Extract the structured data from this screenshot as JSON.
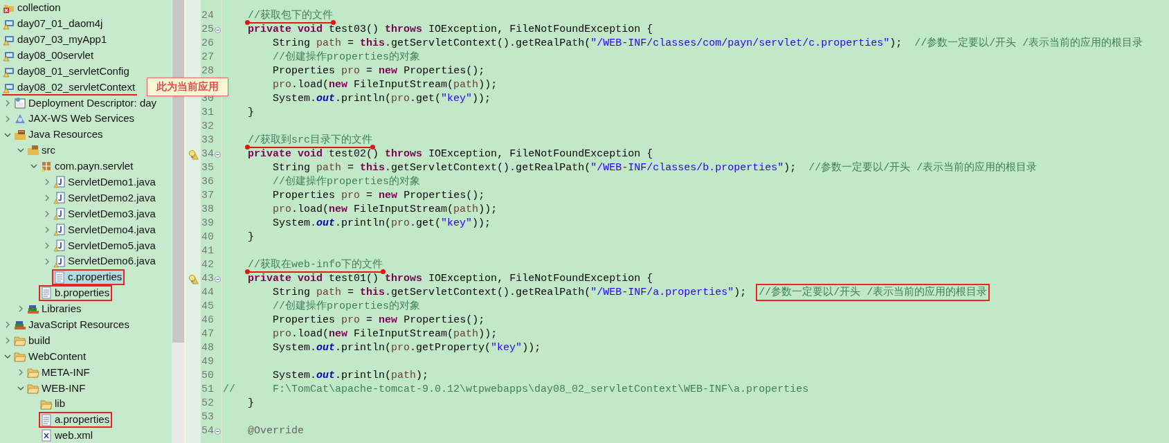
{
  "project_explorer": {
    "items": [
      {
        "label": "collection",
        "kind": "project-error",
        "selected": false
      },
      {
        "label": "day07_01_daom4j",
        "kind": "project",
        "selected": false
      },
      {
        "label": "day07_03_myApp1",
        "kind": "project",
        "selected": false
      },
      {
        "label": "day08_00servlet",
        "kind": "project",
        "selected": false
      },
      {
        "label": "day08_01_servletConfig",
        "kind": "project",
        "selected": false
      },
      {
        "label": "day08_02_servletContext",
        "kind": "project",
        "selected": false,
        "underlined": true,
        "children": [
          {
            "label": "Deployment Descriptor: day",
            "kind": "deployment",
            "expanded": false,
            "selected": false
          },
          {
            "label": "JAX-WS Web Services",
            "kind": "webservices",
            "expanded": false,
            "selected": false
          },
          {
            "label": "Java Resources",
            "kind": "java-resources",
            "expanded": true,
            "selected": false,
            "children": [
              {
                "label": "src",
                "kind": "src-folder",
                "expanded": true,
                "selected": false,
                "children": [
                  {
                    "label": "com.payn.servlet",
                    "kind": "package",
                    "expanded": true,
                    "selected": false,
                    "children": [
                      {
                        "label": "ServletDemo1.java",
                        "kind": "java-file",
                        "expanded": false,
                        "selected": false
                      },
                      {
                        "label": "ServletDemo2.java",
                        "kind": "java-file",
                        "expanded": false,
                        "selected": false
                      },
                      {
                        "label": "ServletDemo3.java",
                        "kind": "java-file",
                        "expanded": false,
                        "selected": false
                      },
                      {
                        "label": "ServletDemo4.java",
                        "kind": "java-file",
                        "expanded": false,
                        "selected": false
                      },
                      {
                        "label": "ServletDemo5.java",
                        "kind": "java-file",
                        "expanded": false,
                        "selected": false
                      },
                      {
                        "label": "ServletDemo6.java",
                        "kind": "java-file",
                        "expanded": false,
                        "selected": false
                      },
                      {
                        "label": "c.properties",
                        "kind": "text-file",
                        "selected": true,
                        "boxed": true
                      }
                    ]
                  },
                  {
                    "label": "b.properties",
                    "kind": "text-file",
                    "selected": false,
                    "boxed": true
                  }
                ]
              },
              {
                "label": "Libraries",
                "kind": "library",
                "expanded": false,
                "selected": false
              }
            ]
          },
          {
            "label": "JavaScript Resources",
            "kind": "library",
            "expanded": false,
            "selected": false
          },
          {
            "label": "build",
            "kind": "folder",
            "expanded": false,
            "selected": false
          },
          {
            "label": "WebContent",
            "kind": "folder",
            "expanded": true,
            "selected": false,
            "children": [
              {
                "label": "META-INF",
                "kind": "folder",
                "expanded": false,
                "selected": false
              },
              {
                "label": "WEB-INF",
                "kind": "folder",
                "expanded": true,
                "selected": false,
                "children": [
                  {
                    "label": "lib",
                    "kind": "folder",
                    "selected": false
                  },
                  {
                    "label": "a.properties",
                    "kind": "text-file",
                    "selected": false,
                    "boxed": true
                  },
                  {
                    "label": "web.xml",
                    "kind": "xml-file",
                    "selected": false
                  }
                ]
              }
            ]
          }
        ]
      }
    ]
  },
  "callout": {
    "text": "此为当前应用"
  },
  "editor": {
    "lines": [
      {
        "number": "24",
        "tokens": [
          {
            "kind": "comment",
            "text": "    //获取包下的文件",
            "underlined": true
          }
        ]
      },
      {
        "number": "25",
        "fold": true,
        "tokens": [
          {
            "kind": "keyword",
            "text": "    private void"
          },
          {
            "kind": "plain",
            "text": " test03() "
          },
          {
            "kind": "keyword",
            "text": "throws"
          },
          {
            "kind": "plain",
            "text": " IOException, FileNotFoundException {"
          }
        ]
      },
      {
        "number": "26",
        "tokens": [
          {
            "kind": "plain",
            "text": "        String "
          },
          {
            "kind": "local",
            "text": "path"
          },
          {
            "kind": "plain",
            "text": " = "
          },
          {
            "kind": "keyword",
            "text": "this"
          },
          {
            "kind": "plain",
            "text": ".getServletContext().getRealPath("
          },
          {
            "kind": "string",
            "text": "\"/WEB-INF/classes/com/payn/servlet/c.properties\""
          },
          {
            "kind": "plain",
            "text": ");  "
          },
          {
            "kind": "comment",
            "text": "//参数一定要以/开头 /表示当前的应用的根目录"
          }
        ]
      },
      {
        "number": "27",
        "tokens": [
          {
            "kind": "comment",
            "text": "        //创建操作properties的对象"
          }
        ]
      },
      {
        "number": "28",
        "tokens": [
          {
            "kind": "plain",
            "text": "        Properties "
          },
          {
            "kind": "local",
            "text": "pro"
          },
          {
            "kind": "plain",
            "text": " = "
          },
          {
            "kind": "keyword",
            "text": "new"
          },
          {
            "kind": "plain",
            "text": " Properties();"
          }
        ]
      },
      {
        "tokens": [
          {
            "kind": "local",
            "text": "        pro"
          },
          {
            "kind": "plain",
            "text": ".load("
          },
          {
            "kind": "keyword",
            "text": "new"
          },
          {
            "kind": "plain",
            "text": " FileInputStream("
          },
          {
            "kind": "local",
            "text": "path"
          },
          {
            "kind": "plain",
            "text": "));"
          }
        ]
      },
      {
        "number": "30",
        "tokens": [
          {
            "kind": "plain",
            "text": "        System."
          },
          {
            "kind": "field",
            "text": "out"
          },
          {
            "kind": "plain",
            "text": ".println("
          },
          {
            "kind": "local",
            "text": "pro"
          },
          {
            "kind": "plain",
            "text": ".get("
          },
          {
            "kind": "string",
            "text": "\"key\""
          },
          {
            "kind": "plain",
            "text": "));"
          }
        ]
      },
      {
        "number": "31",
        "tokens": [
          {
            "kind": "plain",
            "text": "    }"
          }
        ]
      },
      {
        "number": "32"
      },
      {
        "number": "33",
        "tokens": [
          {
            "kind": "comment",
            "text": "    //获取到src目录下的文件",
            "underlined": true
          }
        ]
      },
      {
        "number": "34",
        "fold": true,
        "warning": true,
        "tokens": [
          {
            "kind": "keyword",
            "text": "    private void"
          },
          {
            "kind": "plain",
            "text": " test02() "
          },
          {
            "kind": "keyword",
            "text": "throws"
          },
          {
            "kind": "plain",
            "text": " IOException, FileNotFoundException {"
          }
        ]
      },
      {
        "number": "35",
        "tokens": [
          {
            "kind": "plain",
            "text": "        String "
          },
          {
            "kind": "local",
            "text": "path"
          },
          {
            "kind": "plain",
            "text": " = "
          },
          {
            "kind": "keyword",
            "text": "this"
          },
          {
            "kind": "plain",
            "text": ".getServletContext().getRealPath("
          },
          {
            "kind": "string",
            "text": "\"/WEB-INF/classes/b.properties\""
          },
          {
            "kind": "plain",
            "text": ");  "
          },
          {
            "kind": "comment",
            "text": "//参数一定要以/开头 /表示当前的应用的根目录"
          }
        ]
      },
      {
        "number": "36",
        "tokens": [
          {
            "kind": "comment",
            "text": "        //创建操作properties的对象"
          }
        ]
      },
      {
        "number": "37",
        "tokens": [
          {
            "kind": "plain",
            "text": "        Properties "
          },
          {
            "kind": "local",
            "text": "pro"
          },
          {
            "kind": "plain",
            "text": " = "
          },
          {
            "kind": "keyword",
            "text": "new"
          },
          {
            "kind": "plain",
            "text": " Properties();"
          }
        ]
      },
      {
        "number": "38",
        "tokens": [
          {
            "kind": "local",
            "text": "        pro"
          },
          {
            "kind": "plain",
            "text": ".load("
          },
          {
            "kind": "keyword",
            "text": "new"
          },
          {
            "kind": "plain",
            "text": " FileInputStream("
          },
          {
            "kind": "local",
            "text": "path"
          },
          {
            "kind": "plain",
            "text": "));"
          }
        ]
      },
      {
        "number": "39",
        "tokens": [
          {
            "kind": "plain",
            "text": "        System."
          },
          {
            "kind": "field",
            "text": "out"
          },
          {
            "kind": "plain",
            "text": ".println("
          },
          {
            "kind": "local",
            "text": "pro"
          },
          {
            "kind": "plain",
            "text": ".get("
          },
          {
            "kind": "string",
            "text": "\"key\""
          },
          {
            "kind": "plain",
            "text": "));"
          }
        ]
      },
      {
        "number": "40",
        "tokens": [
          {
            "kind": "plain",
            "text": "    }"
          }
        ]
      },
      {
        "number": "41"
      },
      {
        "number": "42",
        "tokens": [
          {
            "kind": "comment",
            "text": "    //获取在web-info下的文件",
            "underlined": true
          }
        ]
      },
      {
        "number": "43",
        "fold": true,
        "warning": true,
        "tokens": [
          {
            "kind": "keyword",
            "text": "    private void"
          },
          {
            "kind": "plain",
            "text": " test01() "
          },
          {
            "kind": "keyword",
            "text": "throws"
          },
          {
            "kind": "plain",
            "text": " IOException, FileNotFoundException {"
          }
        ]
      },
      {
        "number": "44",
        "tokens": [
          {
            "kind": "plain",
            "text": "        String "
          },
          {
            "kind": "local",
            "text": "path"
          },
          {
            "kind": "plain",
            "text": " = "
          },
          {
            "kind": "keyword",
            "text": "this"
          },
          {
            "kind": "plain",
            "text": ".getServletContext().getRealPath("
          },
          {
            "kind": "string",
            "text": "\"/WEB-INF/a.properties\""
          },
          {
            "kind": "plain",
            "text": ");  "
          },
          {
            "kind": "comment",
            "text": "//参数一定要以/开头 /表示当前的应用的根目录",
            "boxed": true
          }
        ]
      },
      {
        "number": "45",
        "tokens": [
          {
            "kind": "comment",
            "text": "        //创建操作properties的对象"
          }
        ]
      },
      {
        "number": "46",
        "tokens": [
          {
            "kind": "plain",
            "text": "        Properties "
          },
          {
            "kind": "local",
            "text": "pro"
          },
          {
            "kind": "plain",
            "text": " = "
          },
          {
            "kind": "keyword",
            "text": "new"
          },
          {
            "kind": "plain",
            "text": " Properties();"
          }
        ]
      },
      {
        "number": "47",
        "tokens": [
          {
            "kind": "local",
            "text": "        pro"
          },
          {
            "kind": "plain",
            "text": ".load("
          },
          {
            "kind": "keyword",
            "text": "new"
          },
          {
            "kind": "plain",
            "text": " FileInputStream("
          },
          {
            "kind": "local",
            "text": "path"
          },
          {
            "kind": "plain",
            "text": "));"
          }
        ]
      },
      {
        "number": "48",
        "tokens": [
          {
            "kind": "plain",
            "text": "        System."
          },
          {
            "kind": "field",
            "text": "out"
          },
          {
            "kind": "plain",
            "text": ".println("
          },
          {
            "kind": "local",
            "text": "pro"
          },
          {
            "kind": "plain",
            "text": ".getProperty("
          },
          {
            "kind": "string",
            "text": "\"key\""
          },
          {
            "kind": "plain",
            "text": "));"
          }
        ]
      },
      {
        "number": "49"
      },
      {
        "number": "50",
        "tokens": [
          {
            "kind": "plain",
            "text": "        System."
          },
          {
            "kind": "field",
            "text": "out"
          },
          {
            "kind": "plain",
            "text": ".println("
          },
          {
            "kind": "local",
            "text": "path"
          },
          {
            "kind": "plain",
            "text": ");"
          }
        ]
      },
      {
        "number": "51",
        "tokens": [
          {
            "kind": "comment",
            "text": "//      F:\\TomCat\\apache-tomcat-9.0.12\\wtpwebapps\\day08_02_servletContext\\WEB-INF\\a.properties"
          }
        ]
      },
      {
        "number": "52",
        "tokens": [
          {
            "kind": "plain",
            "text": "    }"
          }
        ]
      },
      {
        "number": "53"
      },
      {
        "number": "54",
        "fold": true,
        "tokens": [
          {
            "kind": "annotation",
            "text": "    @Override"
          }
        ]
      }
    ]
  }
}
